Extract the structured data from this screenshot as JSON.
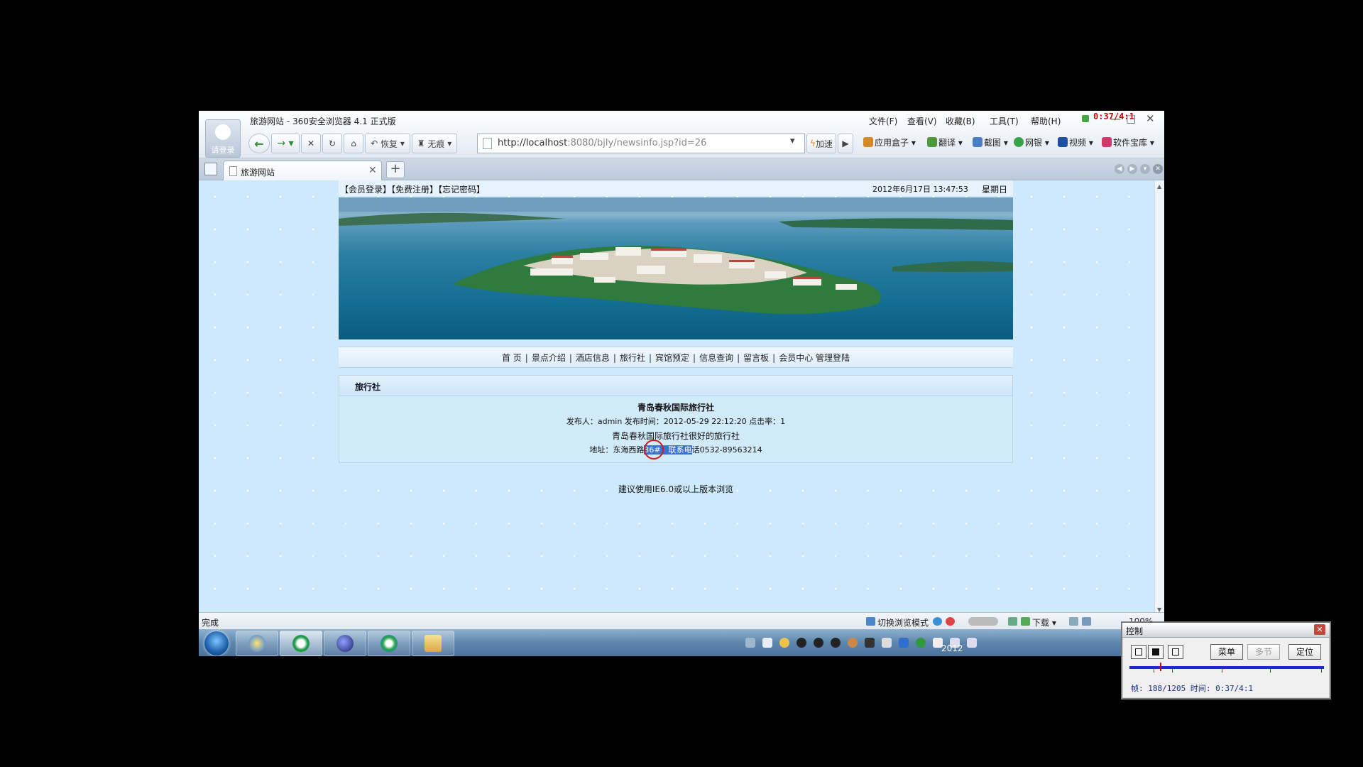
{
  "window": {
    "title": "旅游网站 - 360安全浏览器 4.1 正式版",
    "avatar_label": "请登录",
    "menu": [
      "文件(F)",
      "查看(V)",
      "收藏(B)",
      "工具(T)",
      "帮助(H)"
    ],
    "overlay_time": "0:37/4:1",
    "controls": {
      "min": "—",
      "max": "□",
      "close": "✕"
    }
  },
  "toolbar": {
    "restore_label": "恢复",
    "no_trace_label": "无痕",
    "url_host": "http://localhost",
    "url_path": ":8080/bjly/newsinfo.jsp?id=26",
    "speed_label": "加速",
    "tools": [
      "应用盒子",
      "翻译",
      "截图",
      "网银",
      "视频",
      "软件宝库"
    ]
  },
  "tab": {
    "label": "旅游网站"
  },
  "page": {
    "member_links": [
      "【会员登录】",
      "【免费注册】",
      "【忘记密码】"
    ],
    "datetime": "2012年6月17日 13:47:53",
    "weekday": "星期日",
    "nav": [
      "首 页",
      "景点介绍",
      "酒店信息",
      "旅行社",
      "宾馆预定",
      "信息查询",
      "留言板",
      "会员中心"
    ],
    "nav_admin": "管理登陆",
    "section_title": "旅行社",
    "article": {
      "title": "青岛春秋国际旅行社",
      "meta": "发布人：admin 发布时间：2012-05-29 22:12:20 点击率：1",
      "intro": "青岛春秋国际旅行社很好的旅行社",
      "addr_part1": "地址：东海",
      "addr_part2": "西路",
      "addr_highlight": "36#，联系电",
      "addr_part3": "话0532-89563214"
    },
    "footer_note": "建议使用IE6.0或以上版本浏览"
  },
  "statusbar": {
    "status": "完成",
    "switch_mode": "切换浏览模式",
    "download": "下载",
    "zoom": "100%"
  },
  "taskbar": {
    "tray_year": "2012"
  },
  "control_panel": {
    "title": "控制",
    "buttons": [
      "菜单",
      "多节",
      "定位"
    ],
    "info": "帧: 188/1205 时间: 0:37/4:1",
    "progress": 0.156
  }
}
